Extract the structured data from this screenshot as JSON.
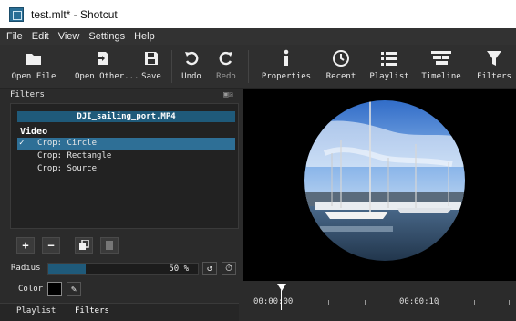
{
  "window": {
    "title": "test.mlt* - Shotcut"
  },
  "menu": [
    "File",
    "Edit",
    "View",
    "Settings",
    "Help"
  ],
  "toolbar": {
    "open_file": "Open File",
    "open_other": "Open Other...",
    "save": "Save",
    "undo": "Undo",
    "redo": "Redo",
    "properties": "Properties",
    "recent": "Recent",
    "playlist": "Playlist",
    "timeline": "Timeline",
    "filters": "Filters"
  },
  "filters_panel": {
    "title": "Filters",
    "clip_name": "DJI_sailing_port.MP4",
    "video_label": "Video",
    "items": [
      {
        "label": "Crop: Circle",
        "checked": true
      },
      {
        "label": "Crop: Rectangle",
        "checked": false
      },
      {
        "label": "Crop: Source",
        "checked": false
      }
    ],
    "check_mark": "✓"
  },
  "params": {
    "radius_label": "Radius",
    "radius_value": 50,
    "radius_display": "50 %",
    "color_label": "Color"
  },
  "bottom_tabs": {
    "playlist": "Playlist",
    "filters": "Filters"
  },
  "timeline": {
    "tc_start": "00:00:00",
    "tc_next": "00:00:10"
  },
  "colors": {
    "accent": "#1f5a7a",
    "selection": "#2e6f96"
  }
}
